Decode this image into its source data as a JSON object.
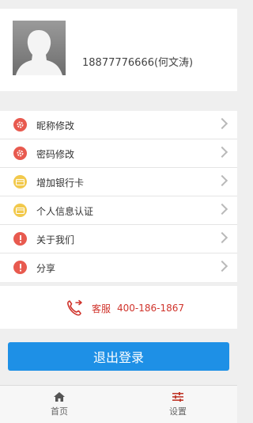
{
  "profile": {
    "name_phone": "18877776666(何文涛)"
  },
  "menu": {
    "items": [
      {
        "label": "昵称修改",
        "icon": "gear-icon",
        "icon_color": "#e85a4f"
      },
      {
        "label": "密码修改",
        "icon": "gear-icon",
        "icon_color": "#e85a4f"
      },
      {
        "label": "增加银行卡",
        "icon": "card-icon",
        "icon_color": "#f2c94c"
      },
      {
        "label": "个人信息认证",
        "icon": "card-icon",
        "icon_color": "#f2c94c"
      },
      {
        "label": "关于我们",
        "icon": "info-icon",
        "icon_color": "#e85a4f"
      },
      {
        "label": "分享",
        "icon": "info-icon",
        "icon_color": "#e85a4f"
      }
    ]
  },
  "service": {
    "label": "客服",
    "number": "400-186-1867",
    "color": "#d0342c"
  },
  "logout": {
    "label": "退出登录",
    "color": "#1e90e6"
  },
  "tabbar": {
    "home_label": "首页",
    "settings_label": "设置",
    "active_color": "#c0392b"
  }
}
